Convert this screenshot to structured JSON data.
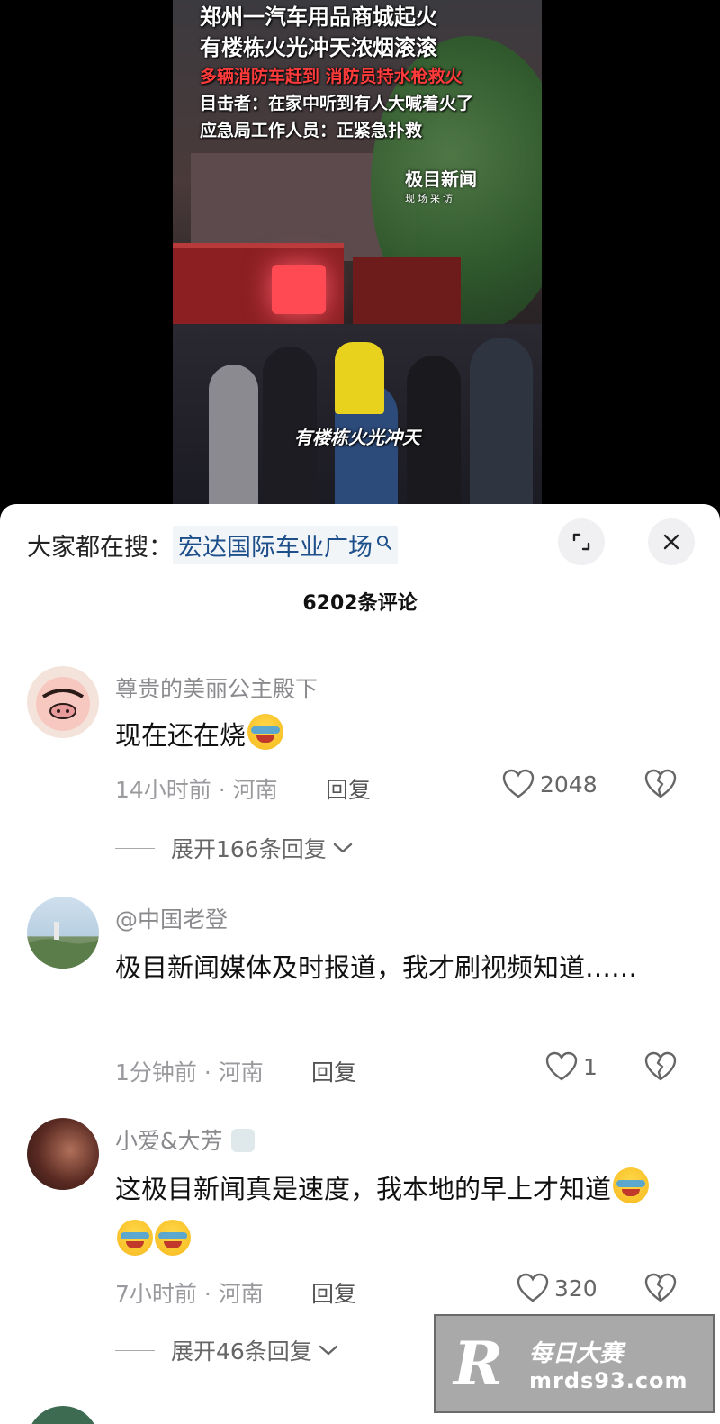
{
  "video": {
    "headline_lines": [
      "郑州一汽车用品商城起火",
      "有楼栋火光冲天浓烟滚滚",
      "多辆消防车赶到 消防员持水枪救火",
      "目击者：在家中听到有人大喊着火了",
      "应急局工作人员：正紧急扑救"
    ],
    "logo_brand": "极目新闻",
    "logo_sub": "现场采访",
    "caption": "有楼栋火光冲天",
    "accent_red": "#ff3b3b"
  },
  "search": {
    "label": "大家都在搜：",
    "term": "宏达国际车业广场",
    "icon": "search-icon"
  },
  "comment_count": "6202条评论",
  "comments": [
    {
      "username": "尊贵的美丽公主殿下",
      "text": "现在还在烧",
      "emoji": [
        "crying-face"
      ],
      "time_location": "14小时前 · 河南",
      "reply_label": "回复",
      "likes": "2048",
      "expand_label": "展开166条回复"
    },
    {
      "username": "@中国老登",
      "text": "极目新闻媒体及时报道，我才刷视频知道……",
      "time_location": "1分钟前 · 河南",
      "reply_label": "回复",
      "likes": "1"
    },
    {
      "username": "小爱&大芳",
      "text": "这极目新闻真是速度，我本地的早上才知道",
      "emoji": [
        "laughing-crying-face",
        "laughing-crying-face",
        "laughing-crying-face"
      ],
      "time_location": "7小时前 · 河南",
      "reply_label": "回复",
      "likes": "320",
      "expand_label": "展开46条回复"
    }
  ],
  "watermark": {
    "logo_letter": "R",
    "name": "每日大赛",
    "url": "mrds93.com"
  }
}
